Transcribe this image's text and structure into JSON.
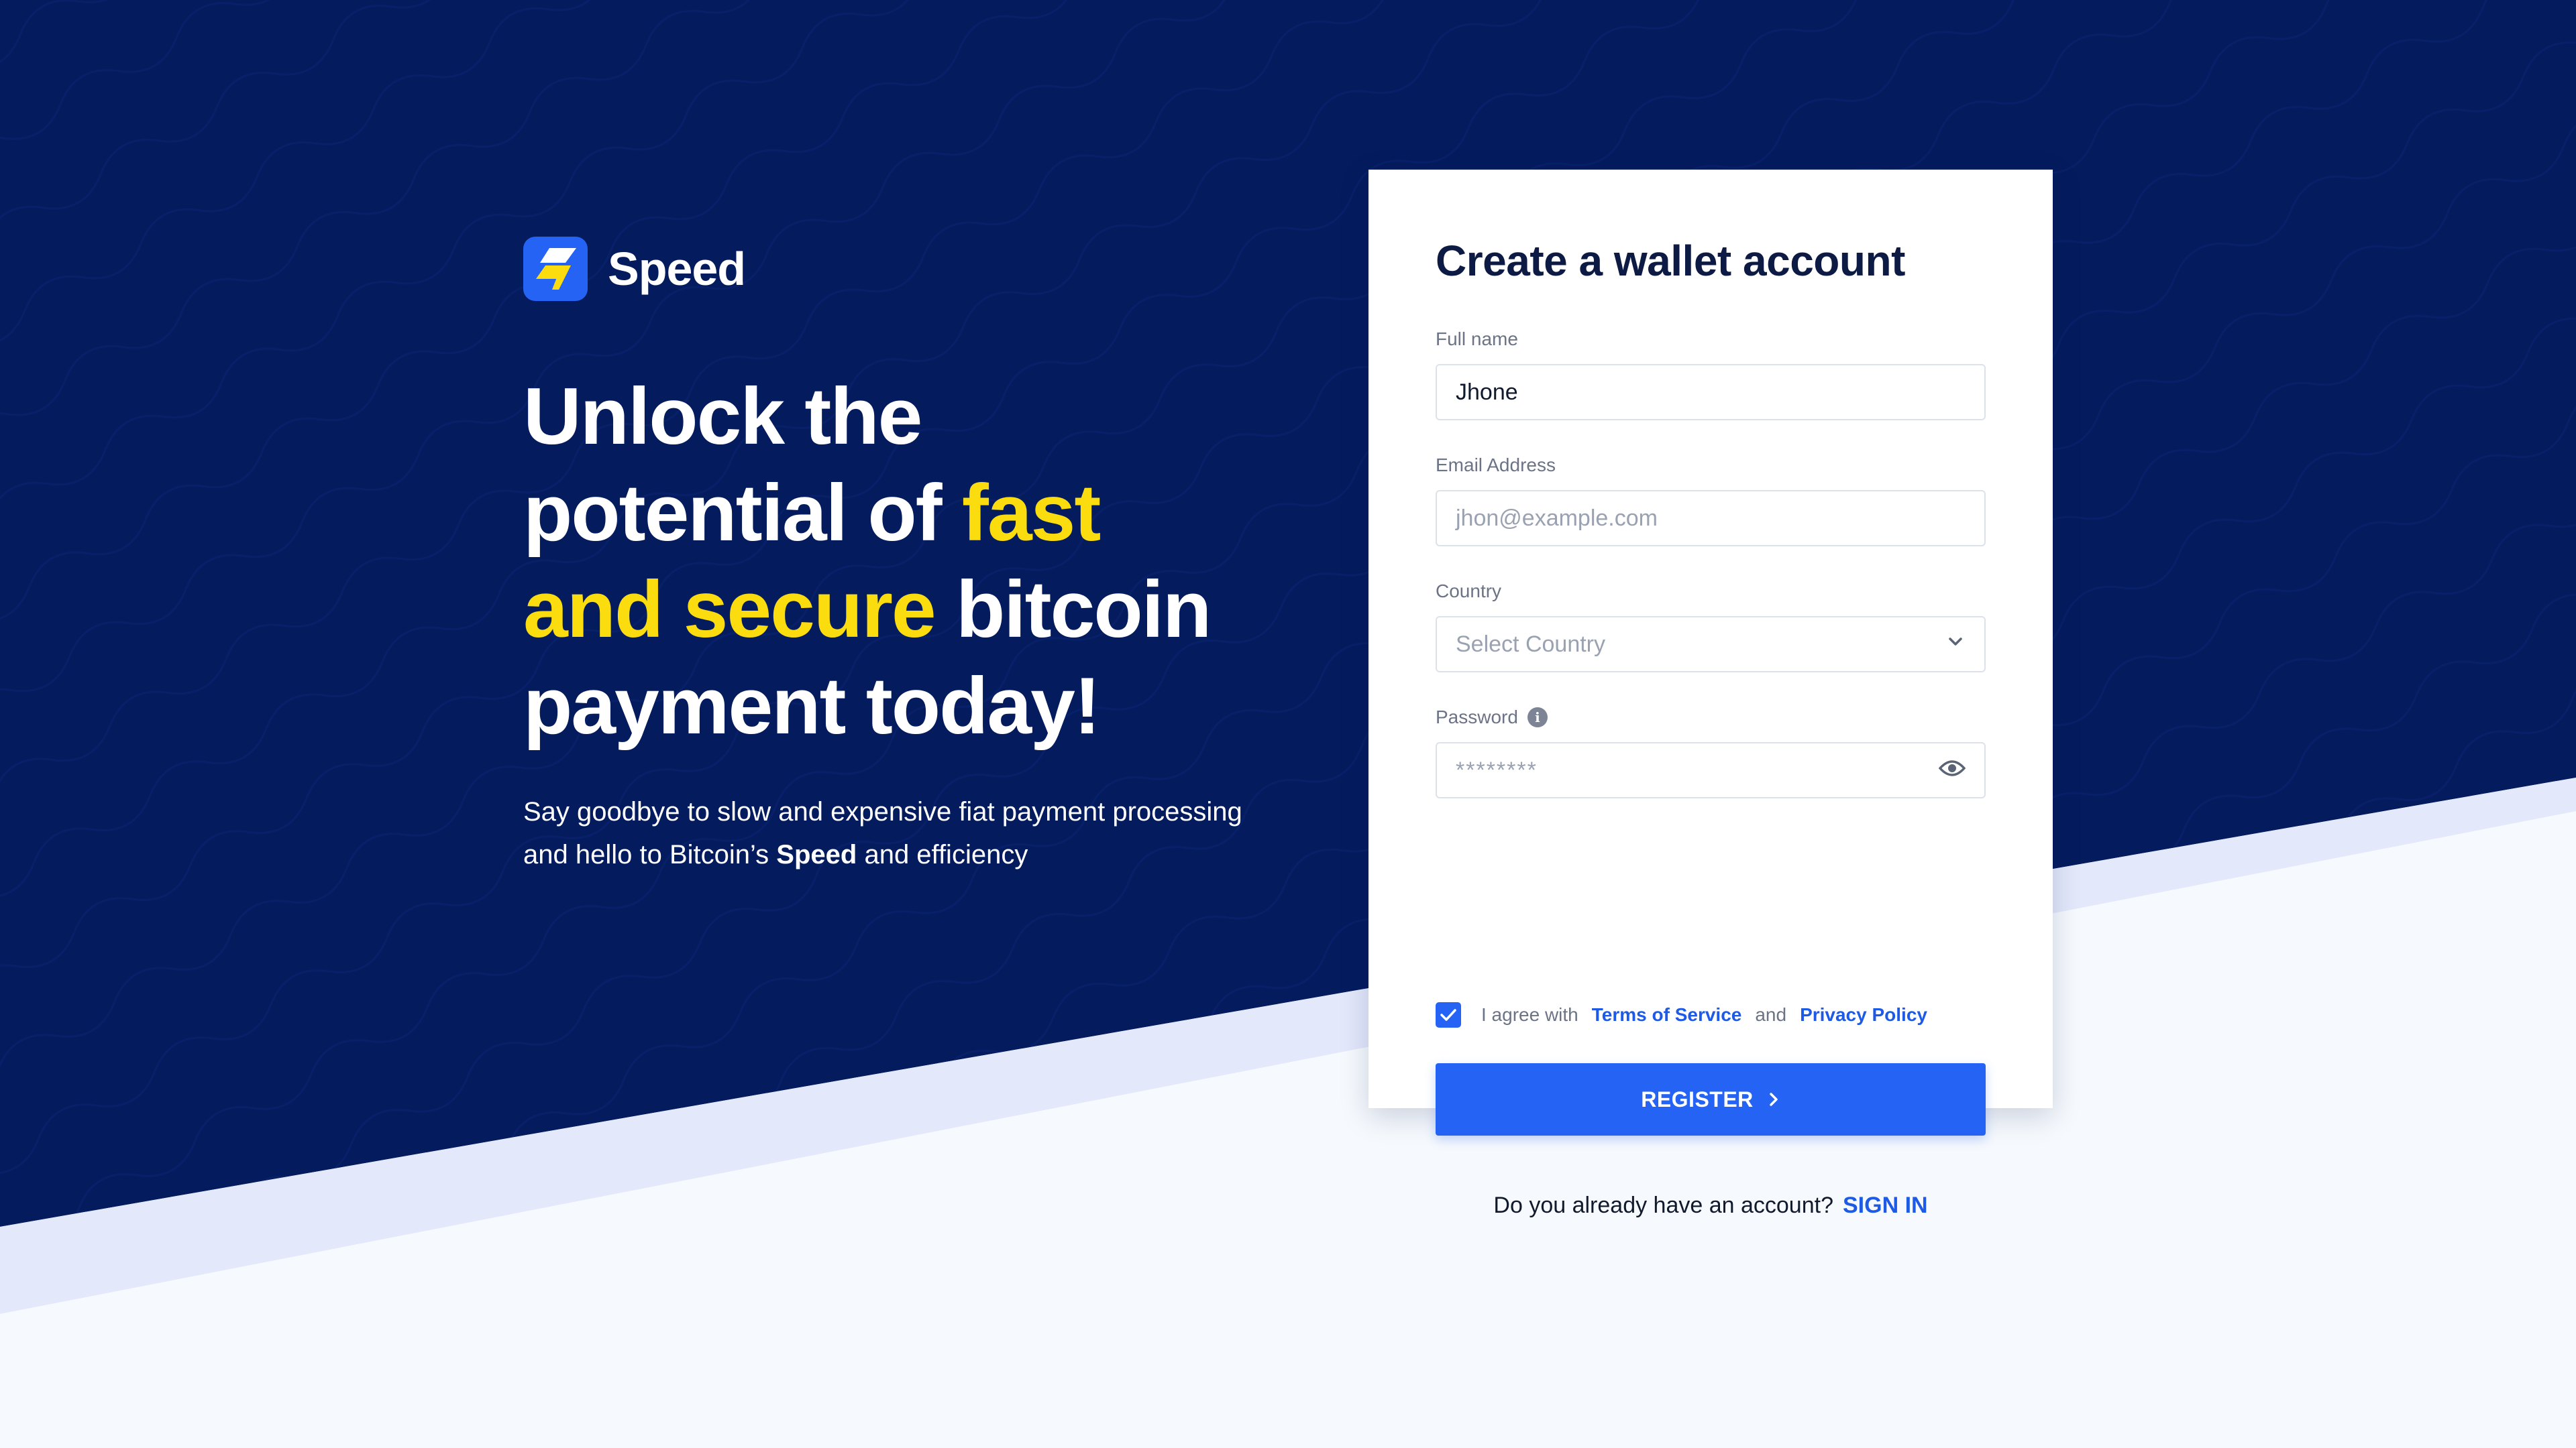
{
  "brand": {
    "name": "Speed"
  },
  "hero": {
    "line1": "Unlock the",
    "line2_pre": "potential of ",
    "line2_hl": "fast",
    "line3_hl": "and secure",
    "line3_post": " bitcoin",
    "line4": "payment today!",
    "sub_pre": "Say goodbye to slow and expensive fiat payment processing and hello to Bitcoin’s ",
    "sub_bold": "Speed",
    "sub_post": " and efficiency"
  },
  "form": {
    "title": "Create a wallet account",
    "full_name_label": "Full name",
    "full_name_value": "Jhone",
    "email_label": "Email Address",
    "email_placeholder": "jhon@example.com",
    "country_label": "Country",
    "country_placeholder": "Select Country",
    "password_label": "Password",
    "password_value": "********",
    "agree_pre": "I agree with",
    "terms_link": "Terms of Service",
    "agree_and": "and",
    "privacy_link": "Privacy Policy",
    "register_label": "REGISTER",
    "signin_prompt": "Do you already have an account?",
    "signin_link": "SIGN IN"
  },
  "colors": {
    "navy": "#041b5e",
    "accent_yellow": "#fbdc0e",
    "primary_blue": "#2563f4",
    "light_band": "#e3e8fb",
    "light_bg": "#f6f9fd"
  },
  "icons": {
    "logo": "lightning-bolt-icon",
    "info": "info-icon",
    "dropdown": "chevron-down-icon",
    "password_toggle": "eye-icon",
    "checkbox": "check-icon",
    "register": "chevron-right-icon"
  }
}
